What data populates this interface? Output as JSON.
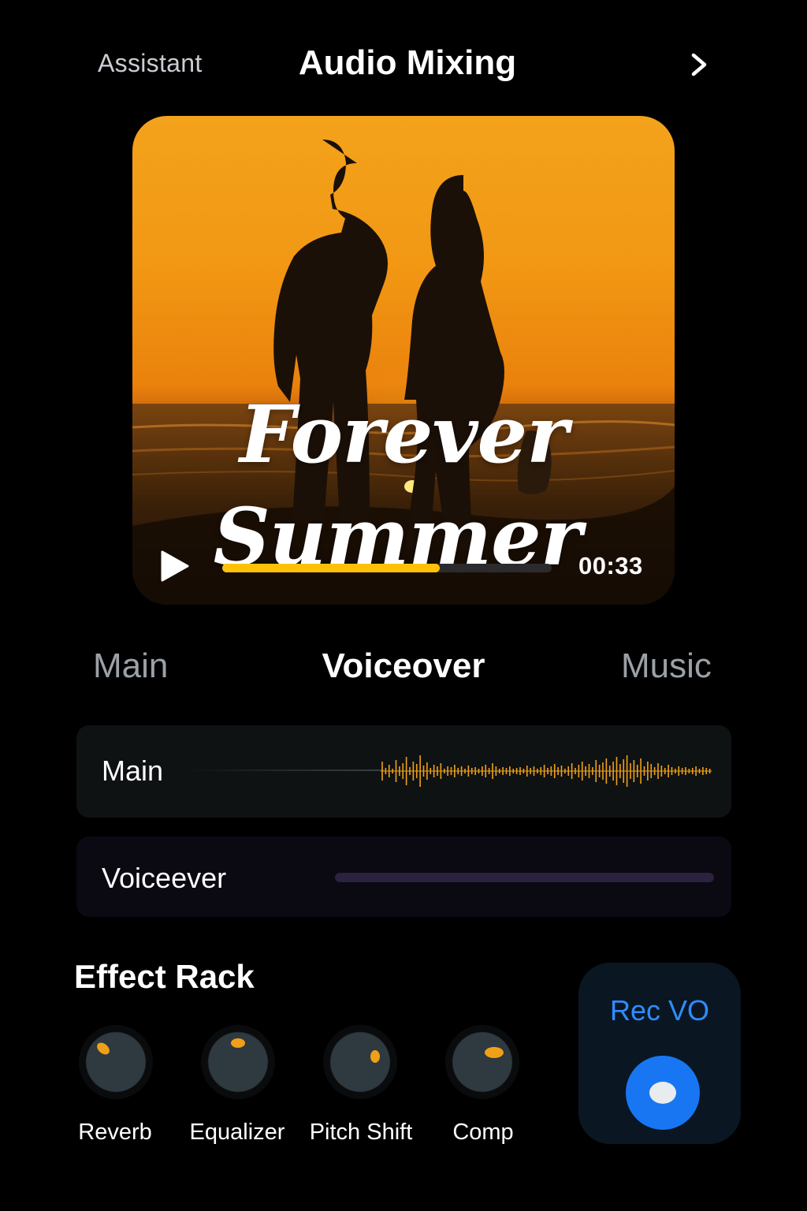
{
  "header": {
    "left_label": "Assistant",
    "title": "Audio Mixing",
    "next_icon": "chevron-right-icon"
  },
  "player": {
    "title_line1": "Forever",
    "title_line2": "Summer",
    "time": "00:33",
    "progress": 0.66,
    "play_icon": "play-icon",
    "accent_color": "#ffc107"
  },
  "tabs": [
    {
      "label": "Main",
      "active": false
    },
    {
      "label": "Voiceover",
      "active": true
    },
    {
      "label": "Music",
      "active": false
    }
  ],
  "tracks": [
    {
      "label": "Main",
      "waveform_color": "#f0a018"
    },
    {
      "label": "Voiceever",
      "bar_color": "#2b2240"
    }
  ],
  "effect_rack": {
    "title": "Effect Rack",
    "knobs": [
      {
        "label": "Reverb"
      },
      {
        "label": "Equalizer"
      },
      {
        "label": "Pitch Shift"
      },
      {
        "label": "Comp"
      }
    ]
  },
  "record": {
    "label": "Rec VO",
    "button_color": "#1876f2",
    "icon": "record-icon"
  }
}
